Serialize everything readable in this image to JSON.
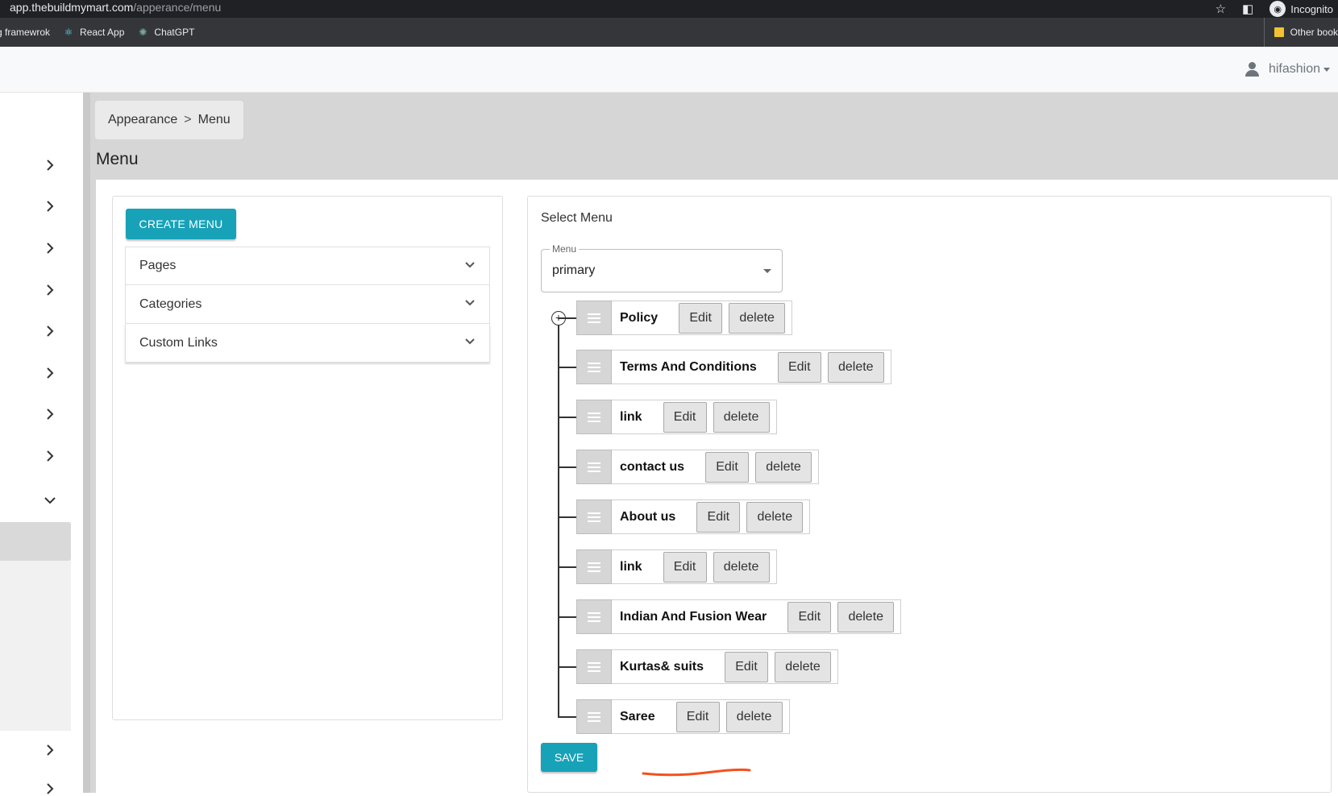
{
  "browser": {
    "url_host": "app.thebuildmymart.com",
    "url_path": "/apperance/menu",
    "profile_label": "Incognito",
    "bookmarks": [
      {
        "label": "g framewrok",
        "icon": ""
      },
      {
        "label": "React App",
        "icon": "react-icon"
      },
      {
        "label": "ChatGPT",
        "icon": "chatgpt-icon"
      }
    ],
    "other_bookmarks": "Other book"
  },
  "header": {
    "username": "hifashion"
  },
  "breadcrumb": {
    "parent": "Appearance",
    "separator": ">",
    "current": "Menu"
  },
  "page": {
    "title": "Menu"
  },
  "left_panel": {
    "create_button": "CREATE MENU",
    "accordion": [
      "Pages",
      "Categories",
      "Custom Links"
    ]
  },
  "right_panel": {
    "select_label": "Select Menu",
    "menu_field_legend": "Menu",
    "menu_field_value": "primary",
    "items": [
      {
        "label": "Policy",
        "edit": "Edit",
        "delete": "delete"
      },
      {
        "label": "Terms And Conditions",
        "edit": "Edit",
        "delete": "delete"
      },
      {
        "label": "link",
        "edit": "Edit",
        "delete": "delete"
      },
      {
        "label": "contact us",
        "edit": "Edit",
        "delete": "delete"
      },
      {
        "label": "About us",
        "edit": "Edit",
        "delete": "delete"
      },
      {
        "label": "link",
        "edit": "Edit",
        "delete": "delete"
      },
      {
        "label": "Indian And Fusion Wear",
        "edit": "Edit",
        "delete": "delete"
      },
      {
        "label": "Kurtas& suits",
        "edit": "Edit",
        "delete": "delete"
      },
      {
        "label": "Saree",
        "edit": "Edit",
        "delete": "delete"
      }
    ],
    "save_button": "SAVE"
  },
  "colors": {
    "accent": "#17a2b8",
    "annotation": "#f4511e"
  }
}
